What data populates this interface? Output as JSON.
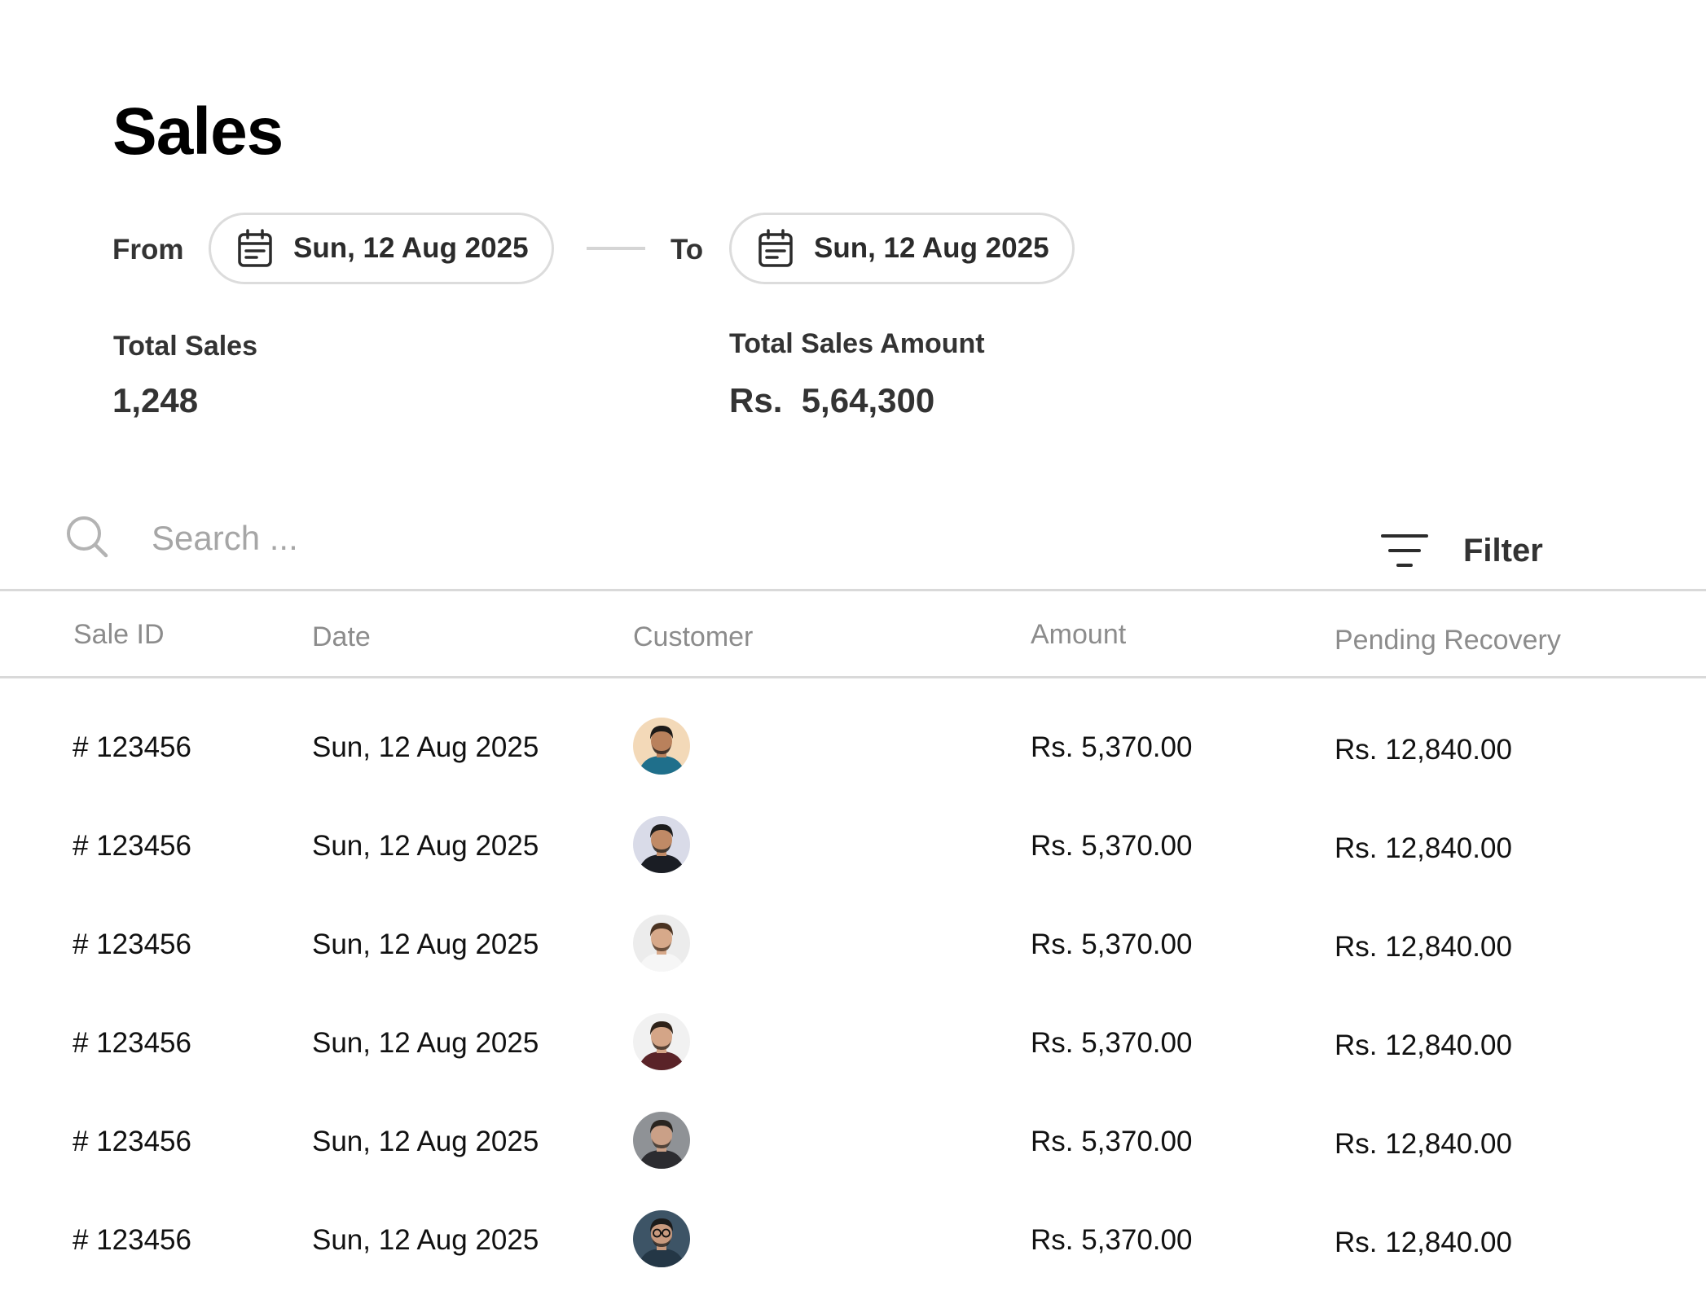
{
  "page": {
    "title": "Sales"
  },
  "date_range": {
    "from_label": "From",
    "from_value": "Sun, 12 Aug 2025",
    "to_label": "To",
    "to_value": "Sun, 12 Aug 2025"
  },
  "stats": {
    "total_sales_label": "Total Sales",
    "total_sales_value": "1,248",
    "total_amount_label": "Total Sales Amount",
    "total_amount_value": "Rs.  5,64,300"
  },
  "search": {
    "placeholder": "Search ...",
    "value": ""
  },
  "filter": {
    "label": "Filter"
  },
  "table": {
    "headers": {
      "sale_id": "Sale ID",
      "date": "Date",
      "customer": "Customer",
      "amount": "Amount",
      "pending": "Pending Recovery"
    },
    "rows": [
      {
        "sale_id": "# 123456",
        "date": "Sun, 12 Aug 2025",
        "amount": "Rs. 5,370.00",
        "pending": "Rs. 12,840.00",
        "avatar": {
          "bg": "#f3d9b8",
          "skin": "#b9815c",
          "hair": "#1d1a18",
          "shirt": "#1f6f8b",
          "glasses": false
        }
      },
      {
        "sale_id": "# 123456",
        "date": "Sun, 12 Aug 2025",
        "amount": "Rs. 5,370.00",
        "pending": "Rs. 12,840.00",
        "avatar": {
          "bg": "#d9dbe8",
          "skin": "#c08a66",
          "hair": "#1c1c1c",
          "shirt": "#1a1d24",
          "glasses": false
        }
      },
      {
        "sale_id": "# 123456",
        "date": "Sun, 12 Aug 2025",
        "amount": "Rs. 5,370.00",
        "pending": "Rs. 12,840.00",
        "avatar": {
          "bg": "#ececec",
          "skin": "#d7a98a",
          "hair": "#4a3322",
          "shirt": "#f6f6f6",
          "glasses": false
        }
      },
      {
        "sale_id": "# 123456",
        "date": "Sun, 12 Aug 2025",
        "amount": "Rs. 5,370.00",
        "pending": "Rs. 12,840.00",
        "avatar": {
          "bg": "#f1f1f1",
          "skin": "#d4a587",
          "hair": "#2e2219",
          "shirt": "#5a2328",
          "glasses": false
        }
      },
      {
        "sale_id": "# 123456",
        "date": "Sun, 12 Aug 2025",
        "amount": "Rs. 5,370.00",
        "pending": "Rs. 12,840.00",
        "avatar": {
          "bg": "#8f9296",
          "skin": "#caa087",
          "hair": "#2a2520",
          "shirt": "#2c2c30",
          "glasses": false
        }
      },
      {
        "sale_id": "# 123456",
        "date": "Sun, 12 Aug 2025",
        "amount": "Rs. 5,370.00",
        "pending": "Rs. 12,840.00",
        "avatar": {
          "bg": "#3d5466",
          "skin": "#c99a7e",
          "hair": "#1b1b1b",
          "shirt": "#243746",
          "glasses": true
        }
      }
    ]
  },
  "icons": {
    "calendar": "calendar-icon",
    "search": "search-icon",
    "filter": "filter-icon"
  },
  "colors": {
    "text_primary": "#111111",
    "text_secondary": "#333333",
    "text_muted": "#8c8c8c",
    "border": "#dcdcdc"
  }
}
